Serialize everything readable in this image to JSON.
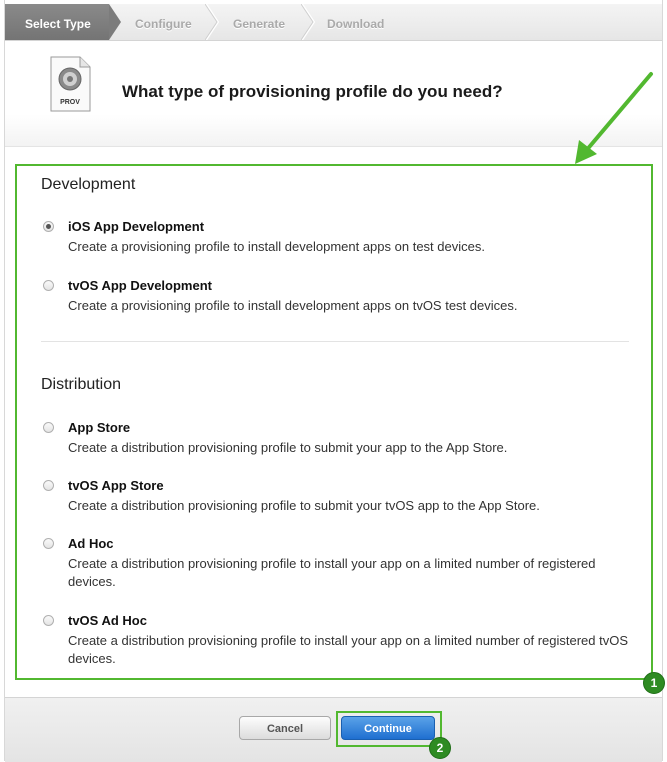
{
  "steps": [
    {
      "label": "Select Type",
      "active": true
    },
    {
      "label": "Configure",
      "active": false
    },
    {
      "label": "Generate",
      "active": false
    },
    {
      "label": "Download",
      "active": false
    }
  ],
  "header": {
    "icon_text": "PROV",
    "title": "What type of provisioning profile do you need?"
  },
  "development": {
    "title": "Development",
    "options": [
      {
        "label": "iOS App Development",
        "description": "Create a provisioning profile to install development apps on test devices.",
        "selected": true
      },
      {
        "label": "tvOS App Development",
        "description": "Create a provisioning profile to install development apps on tvOS test devices.",
        "selected": false
      }
    ]
  },
  "distribution": {
    "title": "Distribution",
    "options": [
      {
        "label": "App Store",
        "description": "Create a distribution provisioning profile to submit your app to the App Store.",
        "selected": false
      },
      {
        "label": "tvOS App Store",
        "description": "Create a distribution provisioning profile to submit your tvOS app to the App Store.",
        "selected": false
      },
      {
        "label": "Ad Hoc",
        "description": "Create a distribution provisioning profile to install your app on a limited number of registered devices.",
        "selected": false
      },
      {
        "label": "tvOS Ad Hoc",
        "description": "Create a distribution provisioning profile to install your app on a limited number of registered tvOS devices.",
        "selected": false
      }
    ]
  },
  "annotations": {
    "badge_1": "1",
    "badge_2": "2",
    "highlight_color": "#52b830",
    "badge_color": "#2e8b22"
  },
  "footer": {
    "cancel_label": "Cancel",
    "continue_label": "Continue"
  }
}
